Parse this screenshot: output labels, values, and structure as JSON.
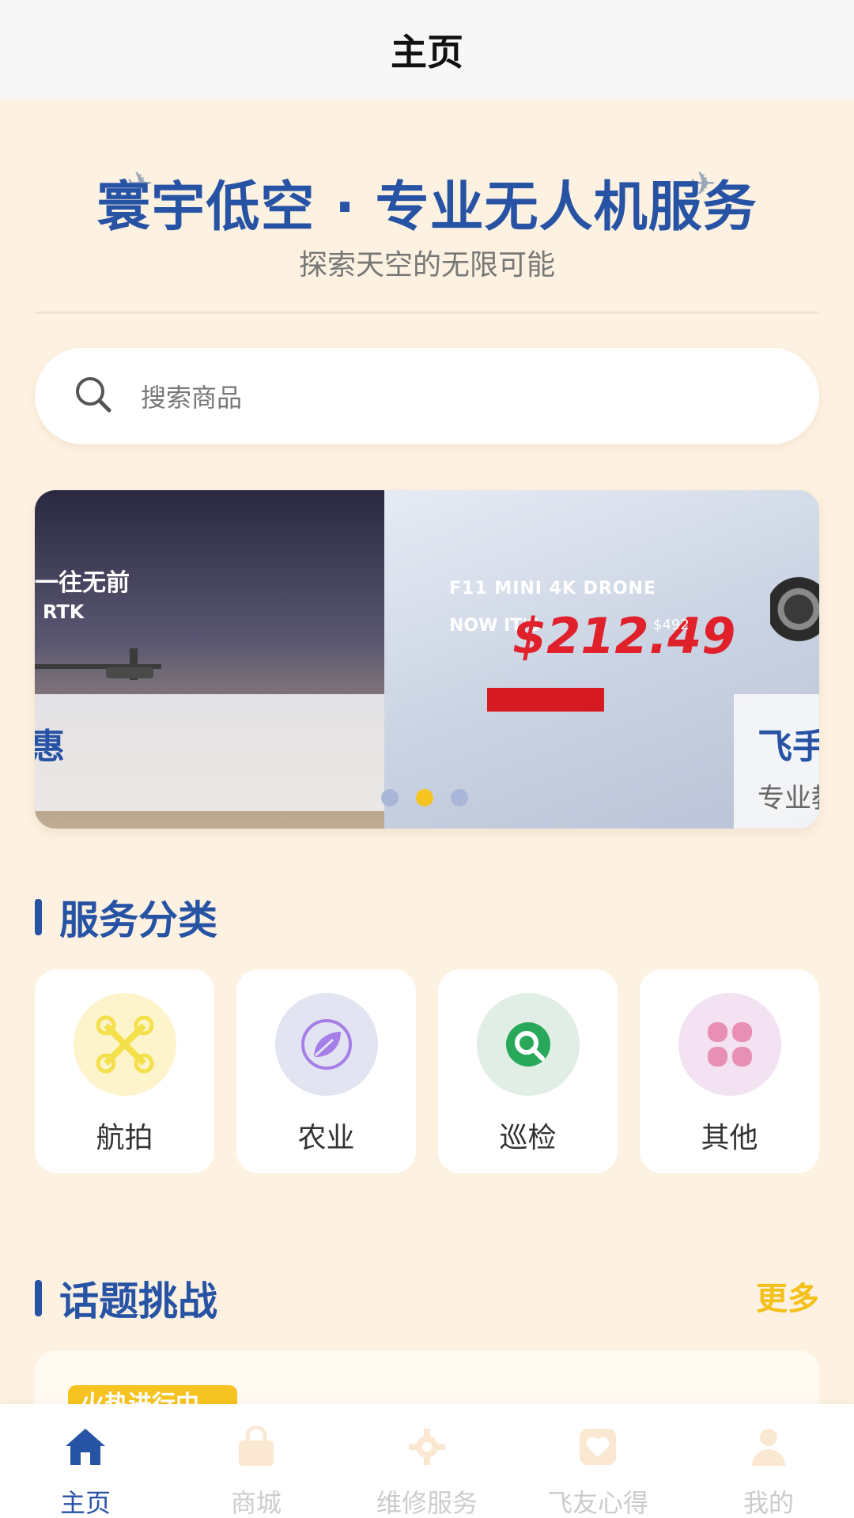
{
  "titlebar": {
    "title": "主页"
  },
  "hero": {
    "title": "寰宇低空 · 专业无人机服务",
    "subtitle": "探索天空的无限可能"
  },
  "search": {
    "placeholder": "搜索商品"
  },
  "banner": {
    "slide_left": {
      "line1": "一往无前",
      "line2": "RTK",
      "caption_title": "惠"
    },
    "slide_right": {
      "product": "F11 MINI 4K DRONE",
      "now_its": "NOW IT'S",
      "price": "$212.49",
      "old_price": "$492",
      "caption_title": "飞手训练营限时免费体验",
      "caption_subtitle": "专业教练一对一指导"
    },
    "active_dot": 2,
    "dot_count": 3
  },
  "categories_section": {
    "title": "服务分类"
  },
  "categories": [
    {
      "label": "航拍",
      "icon": "drone-icon",
      "bg": "#fdf4cc",
      "color": "#f5e24a"
    },
    {
      "label": "农业",
      "icon": "leaf-icon",
      "bg": "#e2e4f2",
      "color": "#a67ee8"
    },
    {
      "label": "巡检",
      "icon": "inspect-icon",
      "bg": "#e0eee6",
      "color": "#2aa85a"
    },
    {
      "label": "其他",
      "icon": "grid-icon",
      "bg": "#f2e2f2",
      "color": "#e88fb5"
    }
  ],
  "topics_section": {
    "title": "话题挑战",
    "more": "更多"
  },
  "topic_card": {
    "badge": "火热进行中"
  },
  "tabbar": [
    {
      "label": "主页",
      "icon": "home-icon",
      "active": true
    },
    {
      "label": "商城",
      "icon": "bag-icon",
      "active": false
    },
    {
      "label": "维修服务",
      "icon": "gear-icon",
      "active": false
    },
    {
      "label": "飞友心得",
      "icon": "heart-icon",
      "active": false
    },
    {
      "label": "我的",
      "icon": "user-icon",
      "active": false
    }
  ],
  "colors": {
    "brand_blue": "#2753a5",
    "accent_yellow": "#f6c320",
    "background": "#fdf1e1"
  }
}
